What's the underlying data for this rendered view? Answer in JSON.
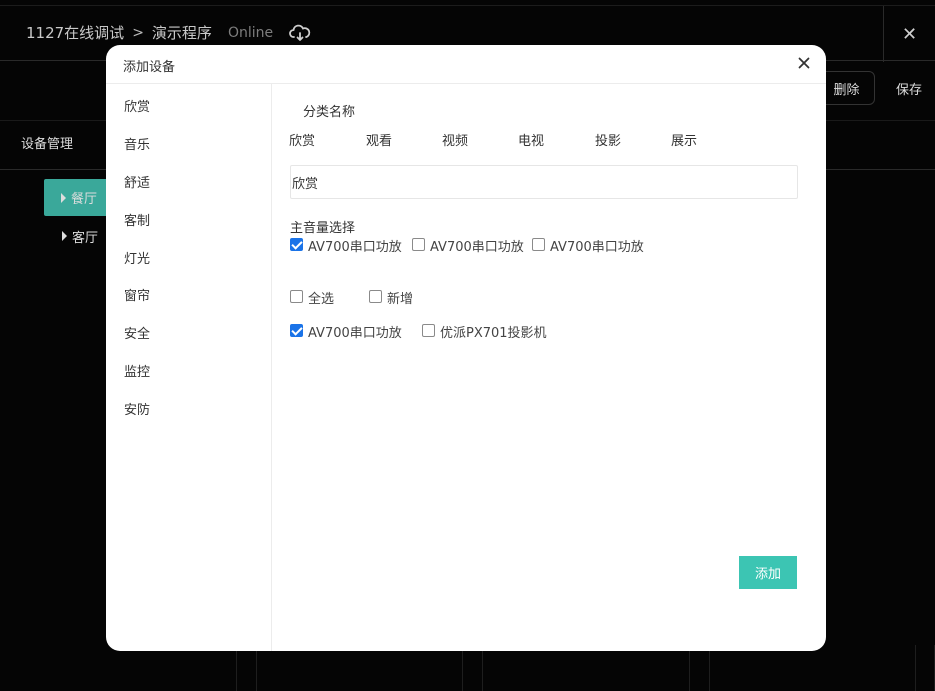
{
  "app": {
    "breadcrumb_project": "1127在线调试",
    "breadcrumb_separator": ">",
    "breadcrumb_program": "演示程序",
    "status": "Online",
    "cloud_icon": "cloud-sync-icon",
    "close_icon": "close-icon",
    "close_symbol": "✕"
  },
  "toolbar": {
    "delete_label": "删除",
    "save_label": "保存"
  },
  "section": {
    "title": "设备管理"
  },
  "tree": {
    "items": [
      {
        "label": "餐厅",
        "active": true
      },
      {
        "label": "客厅",
        "active": false
      }
    ]
  },
  "modal": {
    "title": "添加设备",
    "close_icon": "close-icon",
    "sidebar": {
      "items": [
        "欣赏",
        "音乐",
        "舒适",
        "客制",
        "灯光",
        "窗帘",
        "安全",
        "监控",
        "安防"
      ]
    },
    "category_label": "分类名称",
    "category_tabs": [
      "欣赏",
      "观看",
      "视频",
      "电视",
      "投影",
      "展示"
    ],
    "name_input_value": "欣赏",
    "main_volume_label": "主音量选择",
    "main_volume_options": [
      {
        "label": "AV700串口功放",
        "checked": true
      },
      {
        "label": "AV700串口功放",
        "checked": false
      },
      {
        "label": "AV700串口功放",
        "checked": false
      }
    ],
    "select_all_label": "全选",
    "add_new_label": "新增",
    "device_options": [
      {
        "label": "AV700串口功放",
        "checked": true
      },
      {
        "label": "优派PX701投影机",
        "checked": false
      }
    ],
    "add_button_label": "添加",
    "accent_color": "#3cc5b3",
    "checkbox_color": "#1a73e8"
  }
}
